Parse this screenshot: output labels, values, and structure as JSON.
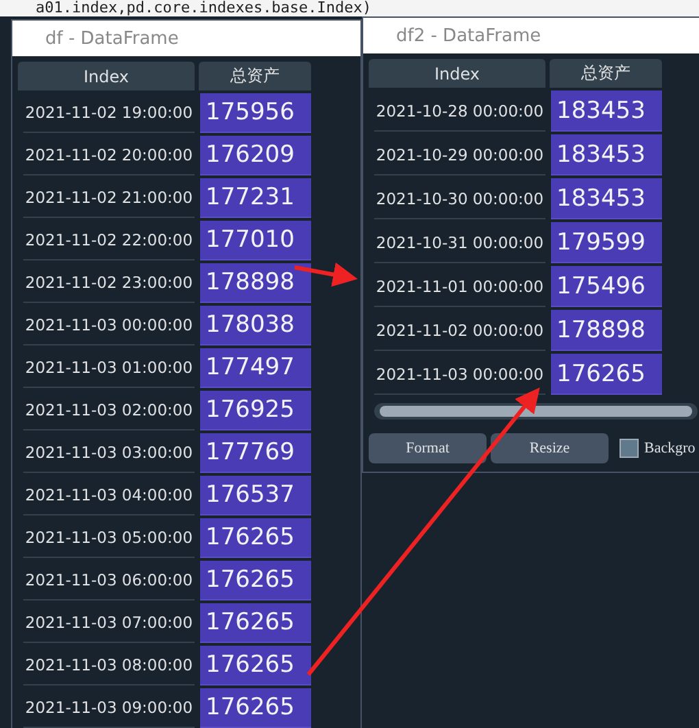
{
  "background_code": "a01.index,pd.core.indexes.base.Index)",
  "windows": [
    {
      "title": "df - DataFrame",
      "columns": [
        "Index",
        "总资产"
      ],
      "rows": [
        {
          "index": "2021-11-02 19:00:00",
          "value": "175956"
        },
        {
          "index": "2021-11-02 20:00:00",
          "value": "176209"
        },
        {
          "index": "2021-11-02 21:00:00",
          "value": "177231"
        },
        {
          "index": "2021-11-02 22:00:00",
          "value": "177010"
        },
        {
          "index": "2021-11-02 23:00:00",
          "value": "178898"
        },
        {
          "index": "2021-11-03 00:00:00",
          "value": "178038"
        },
        {
          "index": "2021-11-03 01:00:00",
          "value": "177497"
        },
        {
          "index": "2021-11-03 02:00:00",
          "value": "176925"
        },
        {
          "index": "2021-11-03 03:00:00",
          "value": "177769"
        },
        {
          "index": "2021-11-03 04:00:00",
          "value": "176537"
        },
        {
          "index": "2021-11-03 05:00:00",
          "value": "176265"
        },
        {
          "index": "2021-11-03 06:00:00",
          "value": "176265"
        },
        {
          "index": "2021-11-03 07:00:00",
          "value": "176265"
        },
        {
          "index": "2021-11-03 08:00:00",
          "value": "176265"
        },
        {
          "index": "2021-11-03 09:00:00",
          "value": "176265"
        }
      ]
    },
    {
      "title": "df2 - DataFrame",
      "columns": [
        "Index",
        "总资产"
      ],
      "rows": [
        {
          "index": "2021-10-28 00:00:00",
          "value": "183453"
        },
        {
          "index": "2021-10-29 00:00:00",
          "value": "183453"
        },
        {
          "index": "2021-10-30 00:00:00",
          "value": "183453"
        },
        {
          "index": "2021-10-31 00:00:00",
          "value": "179599"
        },
        {
          "index": "2021-11-01 00:00:00",
          "value": "175496"
        },
        {
          "index": "2021-11-02 00:00:00",
          "value": "178898"
        },
        {
          "index": "2021-11-03 00:00:00",
          "value": "176265"
        }
      ],
      "buttons": [
        "Format",
        "Resize"
      ],
      "checkbox": {
        "label": "Backgro",
        "checked": false
      }
    }
  ]
}
